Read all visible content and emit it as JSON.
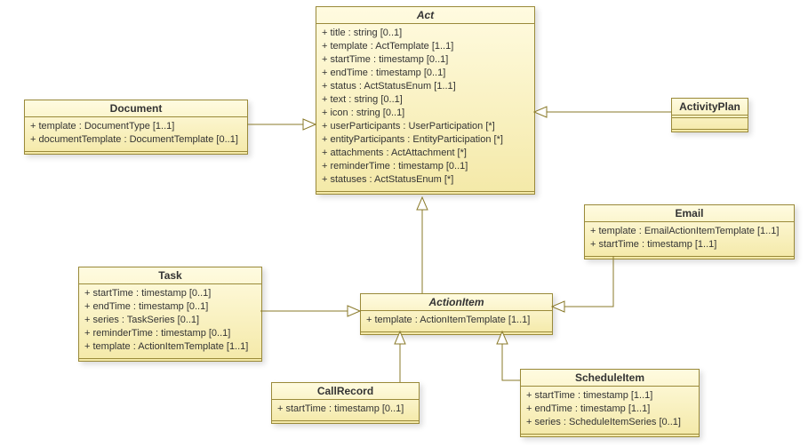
{
  "act": {
    "name": "Act",
    "attrs": [
      "+ title : string [0..1]",
      "+ template : ActTemplate [1..1]",
      "+ startTime : timestamp [0..1]",
      "+ endTime : timestamp [0..1]",
      "+ status : ActStatusEnum [1..1]",
      "+ text : string [0..1]",
      "+ icon : string [0..1]",
      "+ userParticipants : UserParticipation [*]",
      "+ entityParticipants : EntityParticipation [*]",
      "+ attachments : ActAttachment [*]",
      "+ reminderTime : timestamp [0..1]",
      "+ statuses : ActStatusEnum [*]"
    ]
  },
  "document": {
    "name": "Document",
    "attrs": [
      "+ template : DocumentType [1..1]",
      "+ documentTemplate : DocumentTemplate [0..1]"
    ]
  },
  "activityPlan": {
    "name": "ActivityPlan"
  },
  "task": {
    "name": "Task",
    "attrs": [
      "+ startTime : timestamp [0..1]",
      "+ endTime : timestamp [0..1]",
      "+ series : TaskSeries [0..1]",
      "+ reminderTime : timestamp [0..1]",
      "+ template : ActionItemTemplate [1..1]"
    ]
  },
  "actionItem": {
    "name": "ActionItem",
    "attrs": [
      "+ template : ActionItemTemplate [1..1]"
    ]
  },
  "email": {
    "name": "Email",
    "attrs": [
      "+ template : EmailActionItemTemplate [1..1]",
      "+ startTime : timestamp [1..1]"
    ]
  },
  "callRecord": {
    "name": "CallRecord",
    "attrs": [
      "+ startTime : timestamp [0..1]"
    ]
  },
  "scheduleItem": {
    "name": "ScheduleItem",
    "attrs": [
      "+ startTime : timestamp [1..1]",
      "+ endTime : timestamp [1..1]",
      "+ series : ScheduleItemSeries [0..1]"
    ]
  },
  "relationships": [
    {
      "child": "Document",
      "parent": "Act",
      "type": "generalization"
    },
    {
      "child": "ActivityPlan",
      "parent": "Act",
      "type": "generalization"
    },
    {
      "child": "ActionItem",
      "parent": "Act",
      "type": "generalization"
    },
    {
      "child": "Task",
      "parent": "ActionItem",
      "type": "generalization"
    },
    {
      "child": "Email",
      "parent": "ActionItem",
      "type": "generalization"
    },
    {
      "child": "CallRecord",
      "parent": "ActionItem",
      "type": "generalization"
    },
    {
      "child": "ScheduleItem",
      "parent": "ActionItem",
      "type": "generalization"
    }
  ]
}
